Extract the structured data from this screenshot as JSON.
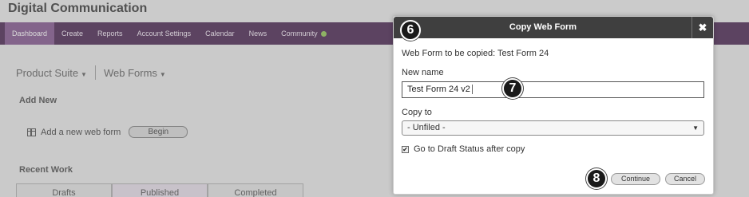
{
  "app": {
    "title": "Digital Communication"
  },
  "nav": {
    "items": [
      {
        "label": "Dashboard"
      },
      {
        "label": "Create"
      },
      {
        "label": "Reports"
      },
      {
        "label": "Account Settings"
      },
      {
        "label": "Calendar"
      },
      {
        "label": "News"
      },
      {
        "label": "Community"
      }
    ]
  },
  "breadcrumb": {
    "suite": "Product Suite",
    "section": "Web Forms"
  },
  "add_new": {
    "heading": "Add New",
    "label": "Add a new web form",
    "button": "Begin"
  },
  "recent_work": {
    "heading": "Recent Work",
    "tabs": [
      "Drafts",
      "Published",
      "Completed"
    ]
  },
  "dialog": {
    "title": "Copy Web Form",
    "close_label": "✖",
    "source_text": "Web Form to be copied: Test Form 24",
    "new_name_label": "New name",
    "new_name_value": "Test Form 24 v2",
    "copy_to_label": "Copy to",
    "copy_to_value": "- Unfiled -",
    "checkbox_label": "Go to Draft Status after copy",
    "checkbox_checked": true,
    "continue_label": "Continue",
    "cancel_label": "Cancel"
  },
  "step_badges": {
    "step_6": "6",
    "step_7": "7",
    "step_8": "8"
  },
  "colors": {
    "nav_bg": "#3e1746",
    "nav_active": "#7a4a86",
    "dialog_header": "#3f3f3f",
    "community_status": "#8bc34a"
  }
}
